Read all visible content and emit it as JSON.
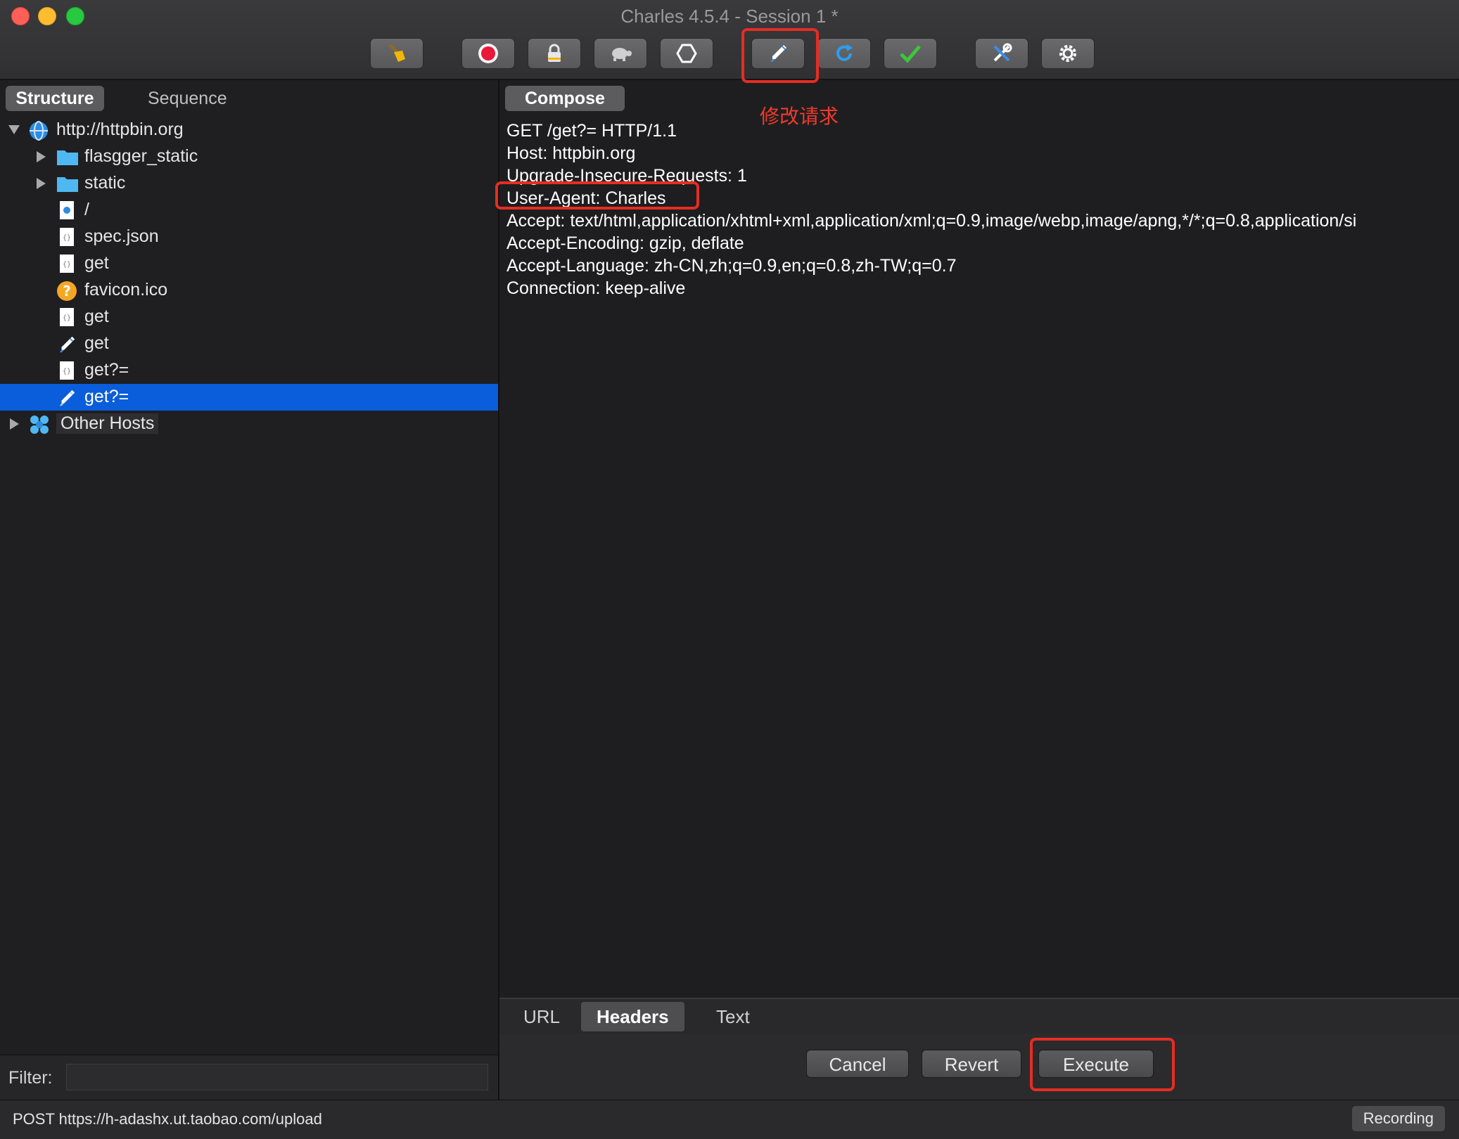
{
  "window": {
    "title": "Charles 4.5.4 - Session 1 *"
  },
  "toolbar": {
    "buttons": [
      {
        "id": "broom",
        "icon": "broom-icon"
      },
      {
        "id": "record",
        "icon": "record-icon"
      },
      {
        "id": "ssl",
        "icon": "lock-icon"
      },
      {
        "id": "throttle",
        "icon": "turtle-icon"
      },
      {
        "id": "breakpoints",
        "icon": "hexagon-icon"
      },
      {
        "id": "compose",
        "icon": "pen-icon"
      },
      {
        "id": "repeat",
        "icon": "refresh-icon"
      },
      {
        "id": "validate",
        "icon": "checkmark-icon"
      },
      {
        "id": "tools",
        "icon": "tools-icon"
      },
      {
        "id": "settings",
        "icon": "gear-icon"
      }
    ]
  },
  "left": {
    "tabs": [
      "Structure",
      "Sequence"
    ],
    "tree": [
      {
        "label": "http://httpbin.org",
        "icon": "globe-icon"
      },
      {
        "label": "flasgger_static",
        "icon": "folder-icon"
      },
      {
        "label": "static",
        "icon": "folder-icon"
      },
      {
        "label": "/",
        "icon": "page-icon"
      },
      {
        "label": "spec.json",
        "icon": "json-file-icon"
      },
      {
        "label": "get",
        "icon": "json-file-icon"
      },
      {
        "label": "favicon.ico",
        "icon": "question-icon"
      },
      {
        "label": "get",
        "icon": "json-file-icon"
      },
      {
        "label": "get",
        "icon": "pen-icon"
      },
      {
        "label": "get?=",
        "icon": "json-file-icon"
      },
      {
        "label": "get?=",
        "icon": "pen-icon"
      },
      {
        "label": "Other Hosts",
        "icon": "hosts-icon"
      }
    ],
    "filter_label": "Filter:",
    "filter_value": ""
  },
  "right": {
    "compose_tab": "Compose",
    "annotation": "修改请求",
    "request_lines": [
      "GET /get?= HTTP/1.1",
      "Host: httpbin.org",
      "Upgrade-Insecure-Requests: 1",
      "User-Agent: Charles",
      "Accept: text/html,application/xhtml+xml,application/xml;q=0.9,image/webp,image/apng,*/*;q=0.8,application/si",
      "Accept-Encoding: gzip, deflate",
      "Accept-Language: zh-CN,zh;q=0.9,en;q=0.8,zh-TW;q=0.7",
      "Connection: keep-alive"
    ],
    "bottom_tabs": [
      "URL",
      "Headers",
      "Text"
    ],
    "actions": {
      "cancel": "Cancel",
      "revert": "Revert",
      "execute": "Execute"
    }
  },
  "status": {
    "text": "POST https://h-adashx.ut.taobao.com/upload",
    "recording": "Recording"
  },
  "colors": {
    "accent": "#0a5ddb",
    "annotation": "#e52d23"
  }
}
